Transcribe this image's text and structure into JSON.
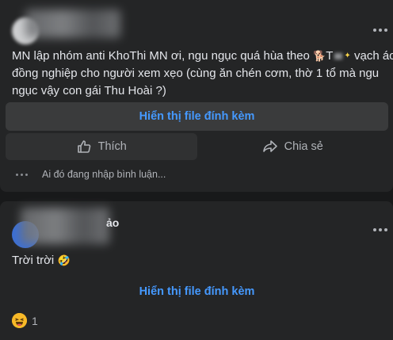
{
  "post1": {
    "text_line1": "MN lập nhóm anti KhoThi MN ơi, ngu ngục quá hùa theo",
    "text_mid": "T",
    "text_end": "vạch áo",
    "text_line2": "đồng nghiệp cho người xem xẹo (cùng ăn chén cơm, thờ 1 tổ mà ngu",
    "text_line3": "ngục vậy con gái Thu Hoài ?)",
    "attachment_label": "Hiển thị file đính kèm",
    "like_label": "Thích",
    "share_label": "Chia sẻ",
    "typing_label": "Ai đó đang nhập bình luận..."
  },
  "post2": {
    "name_suffix": "ảo",
    "text": "Trời trời",
    "attachment_label": "Hiển thị file đính kèm",
    "reaction_count": "1"
  },
  "icons": {
    "more": "more-dots-icon",
    "like": "thumbs-up-icon",
    "share": "share-arrow-icon",
    "dog": "dog-emoji-icon",
    "laugh": "rofl-emoji-icon",
    "reaction": "haha-reaction-icon"
  },
  "colors": {
    "background": "#18191a",
    "card": "#242526",
    "link_blue": "#4599ff",
    "muted_text": "#b0b3b8",
    "primary_text": "#e4e6eb"
  }
}
